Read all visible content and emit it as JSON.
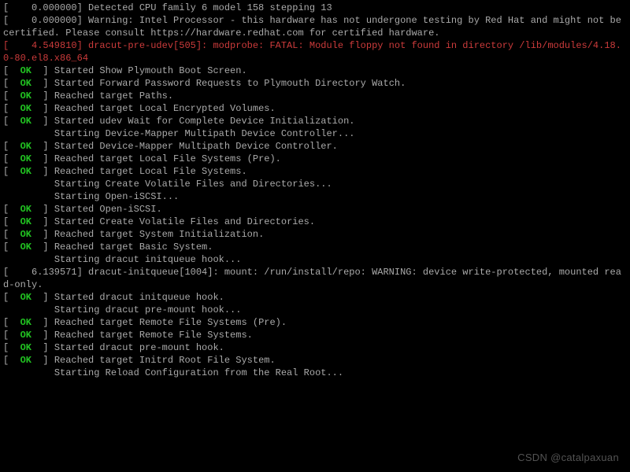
{
  "watermark": "CSDN @catalpaxuan",
  "ok_label": "OK",
  "lines": [
    {
      "type": "ts",
      "ts": "0.000000",
      "text": "Detected CPU family 6 model 158 stepping 13"
    },
    {
      "type": "ts",
      "ts": "0.000000",
      "text": "Warning: Intel Processor - this hardware has not undergone testing by Red Hat and might not be certified. Please consult https://hardware.redhat.com for certified hardware."
    },
    {
      "type": "err",
      "ts": "4.549810",
      "text": "dracut-pre-udev[505]: modprobe: FATAL: Module floppy not found in directory /lib/modules/4.18.0-80.el8.x86_64"
    },
    {
      "type": "ok",
      "text": "Started Show Plymouth Boot Screen."
    },
    {
      "type": "ok",
      "text": "Started Forward Password Requests to Plymouth Directory Watch."
    },
    {
      "type": "ok",
      "text": "Reached target Paths."
    },
    {
      "type": "ok",
      "text": "Reached target Local Encrypted Volumes."
    },
    {
      "type": "ok",
      "text": "Started udev Wait for Complete Device Initialization."
    },
    {
      "type": "ind",
      "text": "Starting Device-Mapper Multipath Device Controller..."
    },
    {
      "type": "ok",
      "text": "Started Device-Mapper Multipath Device Controller."
    },
    {
      "type": "ok",
      "text": "Reached target Local File Systems (Pre)."
    },
    {
      "type": "ok",
      "text": "Reached target Local File Systems."
    },
    {
      "type": "ind",
      "text": "Starting Create Volatile Files and Directories..."
    },
    {
      "type": "ind",
      "text": "Starting Open-iSCSI..."
    },
    {
      "type": "ok",
      "text": "Started Open-iSCSI."
    },
    {
      "type": "ok",
      "text": "Started Create Volatile Files and Directories."
    },
    {
      "type": "ok",
      "text": "Reached target System Initialization."
    },
    {
      "type": "ok",
      "text": "Reached target Basic System."
    },
    {
      "type": "ind",
      "text": "Starting dracut initqueue hook..."
    },
    {
      "type": "ts",
      "ts": "6.139571",
      "text": "dracut-initqueue[1004]: mount: /run/install/repo: WARNING: device write-protected, mounted read-only."
    },
    {
      "type": "ok",
      "text": "Started dracut initqueue hook."
    },
    {
      "type": "ind",
      "text": "Starting dracut pre-mount hook..."
    },
    {
      "type": "ok",
      "text": "Reached target Remote File Systems (Pre)."
    },
    {
      "type": "ok",
      "text": "Reached target Remote File Systems."
    },
    {
      "type": "ok",
      "text": "Started dracut pre-mount hook."
    },
    {
      "type": "ok",
      "text": "Reached target Initrd Root File System."
    },
    {
      "type": "ind",
      "text": "Starting Reload Configuration from the Real Root..."
    }
  ]
}
